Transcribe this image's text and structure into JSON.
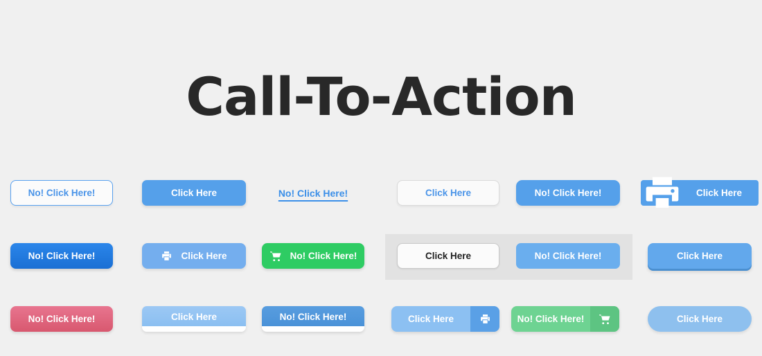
{
  "page": {
    "title": "Call-To-Action",
    "background_color": "#f0f0f0",
    "title_color": "#282828",
    "highlight_band_color": "#e2e2e2"
  },
  "labels": {
    "no_click": "No! Click Here!",
    "click": "Click Here"
  },
  "colors": {
    "primary_blue": "#55a0ea",
    "light_blue": "#8ec0ee",
    "deep_blue": "#1a6fd4",
    "green": "#2ecc63",
    "pink": "#d8586f",
    "link_blue": "#3b8fe8",
    "border_gray": "#d9d9d9",
    "text_dark": "#1f1f1f",
    "white": "#ffffff"
  },
  "buttons": {
    "rows": [
      {
        "row": 1,
        "items": [
          {
            "id": "r1c1",
            "label": "No! Click Here!",
            "style": "outline-blue",
            "icon": null
          },
          {
            "id": "r1c2",
            "label": "Click Here",
            "style": "solid-blue",
            "icon": null
          },
          {
            "id": "r1c3",
            "label": "No! Click Here!",
            "style": "link-underline",
            "icon": null
          },
          {
            "id": "r1c4",
            "label": "Click Here",
            "style": "outline-gray",
            "icon": null
          },
          {
            "id": "r1c5",
            "label": "No! Click Here!",
            "style": "solid-blue-rounded",
            "icon": null
          },
          {
            "id": "r1c6",
            "label": "Click Here",
            "style": "blue-big-icon-left",
            "icon": "printer-icon"
          }
        ]
      },
      {
        "row": 2,
        "items": [
          {
            "id": "r2c1",
            "label": "No! Click Here!",
            "style": "gradient-deep-blue",
            "icon": null
          },
          {
            "id": "r2c2",
            "label": "Click Here",
            "style": "light-blue-icon",
            "icon": "printer-icon"
          },
          {
            "id": "r2c3",
            "label": "No! Click Here!",
            "style": "green-icon",
            "icon": "cart-icon"
          },
          {
            "id": "r2c4",
            "label": "Click Here",
            "style": "white-dark-text",
            "icon": null
          },
          {
            "id": "r2c5",
            "label": "No! Click Here!",
            "style": "flat-blue",
            "icon": null
          },
          {
            "id": "r2c6",
            "label": "Click Here",
            "style": "bevel-blue",
            "icon": null
          }
        ]
      },
      {
        "row": 3,
        "items": [
          {
            "id": "r3c1",
            "label": "No! Click Here!",
            "style": "pink-gradient",
            "icon": null
          },
          {
            "id": "r3c2",
            "label": "Click Here",
            "style": "card-light-blue",
            "icon": null
          },
          {
            "id": "r3c3",
            "label": "No! Click Here!",
            "style": "card-medium-blue",
            "icon": null
          },
          {
            "id": "r3c4",
            "label": "Click Here",
            "style": "split-blue",
            "icon": "printer-icon"
          },
          {
            "id": "r3c5",
            "label": "No! Click Here!",
            "style": "split-green",
            "icon": "cart-icon"
          },
          {
            "id": "r3c6",
            "label": "Click Here",
            "style": "pill-light-blue",
            "icon": null
          }
        ]
      }
    ]
  }
}
